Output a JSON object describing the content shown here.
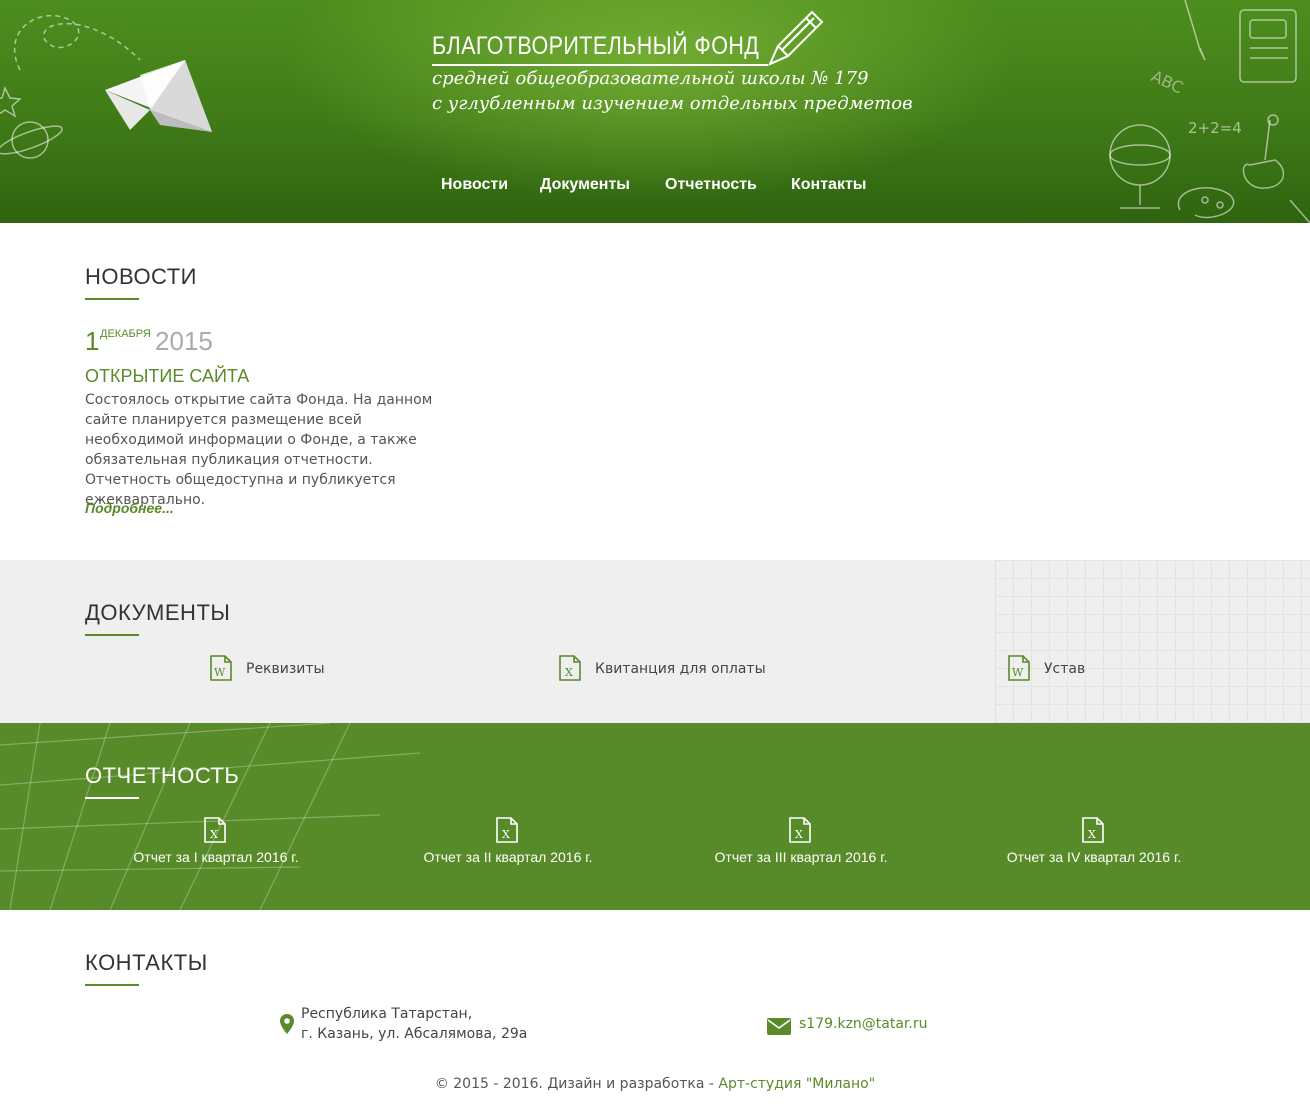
{
  "header": {
    "title": "БЛАГОТВОРИТЕЛЬНЫЙ ФОНД",
    "subtitle_line1": "средней общеобразовательной школы № 179",
    "subtitle_line2": "с углубленным изучением отдельных предметов",
    "chalk_text": "2+2=4",
    "chalk_abc": "ABC"
  },
  "nav": [
    {
      "label": "Новости"
    },
    {
      "label": "Документы"
    },
    {
      "label": "Отчетность"
    },
    {
      "label": "Контакты"
    }
  ],
  "news": {
    "heading": "НОВОСТИ",
    "date_day": "1",
    "date_month": "ДЕКАБРЯ",
    "date_year": "2015",
    "title": "ОТКРЫТИЕ САЙТА",
    "text": "Состоялось открытие сайта Фонда. На данном сайте планируется размещение всей необходимой информации о Фонде, а также обязательная публикация отчетности. Отчетность общедоступна и публикуется ежеквартально.",
    "more": "Подробнее..."
  },
  "documents": {
    "heading": "ДОКУМЕНТЫ",
    "items": [
      {
        "label": "Реквизиты",
        "icon": "word-file-icon"
      },
      {
        "label": "Квитанция для оплаты",
        "icon": "excel-file-icon"
      },
      {
        "label": "Устав",
        "icon": "word-file-icon"
      }
    ]
  },
  "reports": {
    "heading": "ОТЧЕТНОСТЬ",
    "items": [
      {
        "label": "Отчет за I квартал 2016 г.",
        "icon": "excel-file-icon"
      },
      {
        "label": "Отчет за II квартал 2016 г.",
        "icon": "excel-file-icon"
      },
      {
        "label": "Отчет за III квартал 2016 г.",
        "icon": "excel-file-icon"
      },
      {
        "label": "Отчет за IV квартал 2016 г.",
        "icon": "excel-file-icon"
      }
    ]
  },
  "contacts": {
    "heading": "КОНТАКТЫ",
    "address_line1": "Республика Татарстан,",
    "address_line2": "г. Казань, ул. Абсалямова, 29а",
    "email": "s179.kzn@tatar.ru"
  },
  "footer": {
    "text": "© 2015 - 2016. Дизайн и разработка - ",
    "studio": "Арт-студия \"Милано\""
  },
  "colors": {
    "accent": "#5b8a2a",
    "header_green": "#3f7a17",
    "reports_bg": "#578a28",
    "docs_bg": "#efefef"
  }
}
